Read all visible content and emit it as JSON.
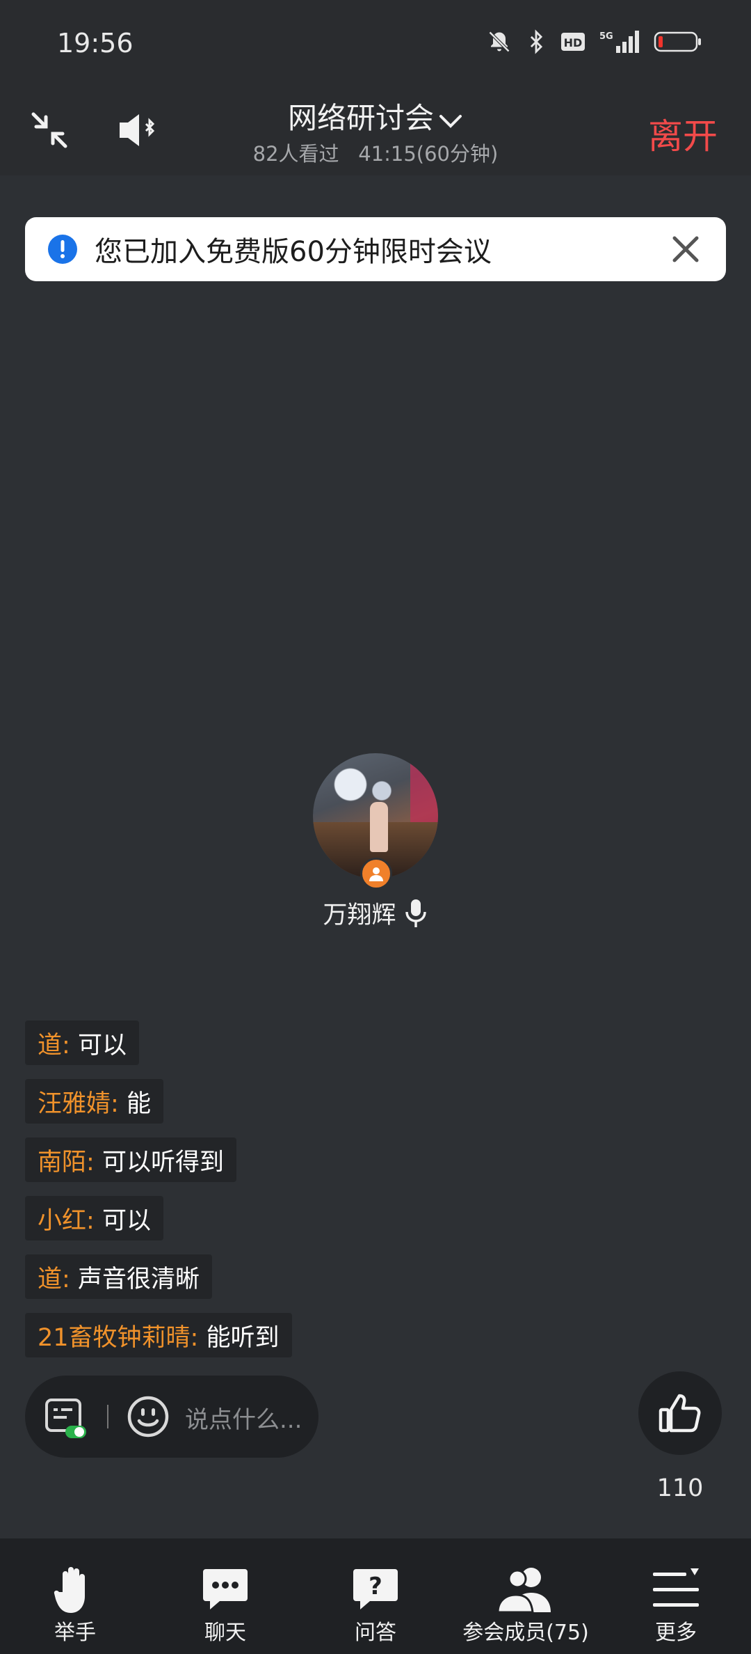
{
  "status_bar": {
    "time": "19:56",
    "hd_label": "HD",
    "net_label": "5G"
  },
  "header": {
    "title": "网络研讨会",
    "viewers": "82人看过",
    "duration": "41:15(60分钟)",
    "leave_label": "离开"
  },
  "notice": {
    "text": "您已加入免费版60分钟限时会议"
  },
  "speaker": {
    "name": "万翔辉"
  },
  "chat": {
    "messages": [
      {
        "name": "道:",
        "text": "可以"
      },
      {
        "name": "汪雅婧:",
        "text": "能"
      },
      {
        "name": "南陌:",
        "text": "可以听得到"
      },
      {
        "name": "小红:",
        "text": "可以"
      },
      {
        "name": "道:",
        "text": "声音很清晰"
      },
      {
        "name": "21畜牧钟莉晴:",
        "text": "能听到"
      }
    ],
    "input_placeholder": "说点什么..."
  },
  "likes": {
    "count": "110"
  },
  "bottom_nav": {
    "items": [
      {
        "label": "举手",
        "icon": "raise-hand-icon"
      },
      {
        "label": "聊天",
        "icon": "chat-icon"
      },
      {
        "label": "问答",
        "icon": "qa-icon"
      },
      {
        "label": "参会成员(75)",
        "icon": "members-icon"
      },
      {
        "label": "更多",
        "icon": "more-icon"
      }
    ]
  },
  "colors": {
    "background": "#2d3034",
    "bar": "#2a2c2f",
    "leave": "#f24a4a",
    "chat_name": "#f0922b",
    "notice_icon": "#1a73e8",
    "host_badge": "#f0802a"
  }
}
